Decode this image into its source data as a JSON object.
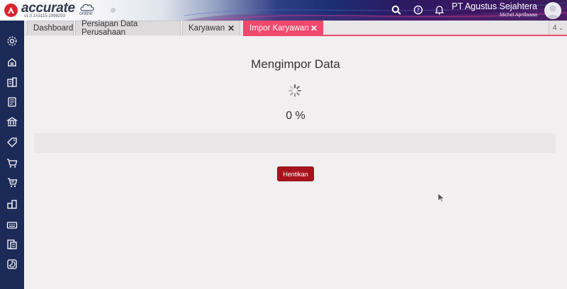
{
  "header": {
    "brand": "accurate",
    "brand_suffix": "online",
    "version": "v1.0.1#3115-1998293",
    "company": "PT Agustus Sejahtera",
    "user": "Michel Aprillaaaa"
  },
  "tabs": [
    {
      "label": "Dashboard",
      "closable": false,
      "active": false
    },
    {
      "label": "Persiapan Data Perusahaan",
      "closable": false,
      "active": false
    },
    {
      "label": "Karyawan",
      "closable": true,
      "active": false
    },
    {
      "label": "Impor Karyawan",
      "closable": true,
      "active": true
    }
  ],
  "tab_count": "4",
  "import": {
    "title": "Mengimpor Data",
    "percent_label": "0 %",
    "progress": 0,
    "stop_label": "Hentikan"
  },
  "sidebar_icons": [
    "settings-icon",
    "company-icon",
    "building-icon",
    "ledger-icon",
    "bank-icon",
    "purchase-tag-icon",
    "cart-icon",
    "sales-cart-icon",
    "inventory-icon",
    "factory-icon",
    "report-icon",
    "invoice-icon",
    "chart-icon"
  ],
  "colors": {
    "accent": "#f0496d",
    "sidebar": "#1c2a58",
    "button": "#a8141c"
  }
}
